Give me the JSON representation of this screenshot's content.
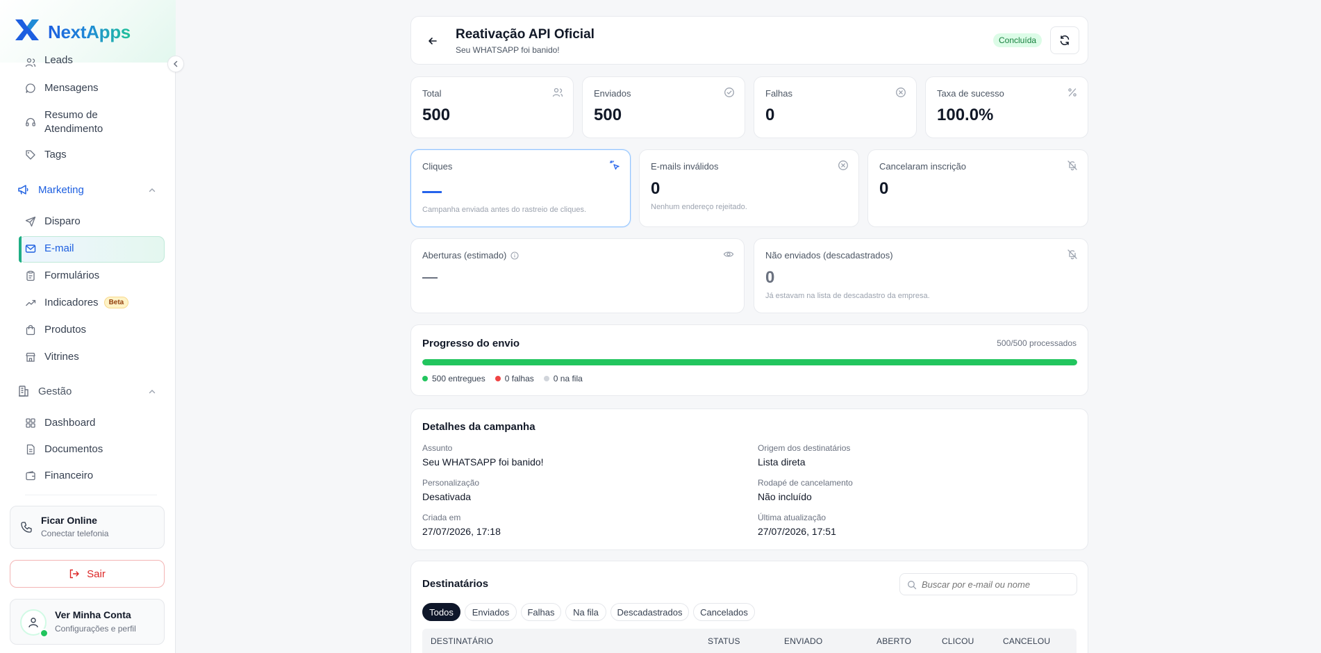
{
  "brand": {
    "name": "NextApps",
    "colors": {
      "primary": "#1d5fe0",
      "accent": "#21c29a"
    }
  },
  "sidebar": {
    "items_top": [
      {
        "label": "Leads",
        "icon": "users-icon"
      },
      {
        "label": "Mensagens",
        "icon": "message-icon"
      },
      {
        "label": "Resumo de Atendimento",
        "icon": "headset-icon"
      },
      {
        "label": "Tags",
        "icon": "tag-icon"
      }
    ],
    "marketing": {
      "label": "Marketing",
      "items": [
        {
          "label": "Disparo",
          "icon": "send-icon"
        },
        {
          "label": "E-mail",
          "icon": "mail-icon",
          "active": true
        },
        {
          "label": "Formulários",
          "icon": "clipboard-icon"
        },
        {
          "label": "Indicadores",
          "icon": "trend-icon",
          "badge": "Beta"
        },
        {
          "label": "Produtos",
          "icon": "bag-icon"
        },
        {
          "label": "Vitrines",
          "icon": "store-icon"
        }
      ]
    },
    "gestao": {
      "label": "Gestão",
      "items": [
        {
          "label": "Dashboard",
          "icon": "grid-icon"
        },
        {
          "label": "Documentos",
          "icon": "document-icon"
        },
        {
          "label": "Financeiro",
          "icon": "wallet-icon"
        }
      ]
    },
    "online": {
      "title": "Ficar Online",
      "subtitle": "Conectar telefonia"
    },
    "logout": "Sair",
    "account": {
      "title": "Ver Minha Conta",
      "subtitle": "Configurações e perfil"
    }
  },
  "header": {
    "title": "Reativação API Oficial",
    "subtitle": "Seu WHATSAPP foi banido!",
    "status": "Concluída"
  },
  "stats": {
    "total": {
      "label": "Total",
      "value": "500"
    },
    "sent": {
      "label": "Enviados",
      "value": "500"
    },
    "failed": {
      "label": "Falhas",
      "value": "0"
    },
    "success": {
      "label": "Taxa de sucesso",
      "value": "100.0%"
    }
  },
  "metrics": {
    "clicks": {
      "label": "Cliques",
      "note": "Campanha enviada antes do rastreio de cliques."
    },
    "invalid": {
      "label": "E-mails inválidos",
      "value": "0",
      "note": "Nenhum endereço rejeitado."
    },
    "unsubscribed": {
      "label": "Cancelaram inscrição",
      "value": "0"
    },
    "opens": {
      "label": "Aberturas (estimado)"
    },
    "not_sent": {
      "label": "Não enviados (descadastrados)",
      "value": "0",
      "note": "Já estavam na lista de descadastro da empresa."
    }
  },
  "progress": {
    "title": "Progresso do envio",
    "processed": "500/500 processados",
    "fraction": 1.0,
    "legend": {
      "delivered": "500 entregues",
      "failed": "0 falhas",
      "queued": "0 na fila"
    }
  },
  "details": {
    "title": "Detalhes da campanha",
    "subject_label": "Assunto",
    "subject": "Seu WHATSAPP foi banido!",
    "origin_label": "Origem dos destinatários",
    "origin": "Lista direta",
    "personalization_label": "Personalização",
    "personalization": "Desativada",
    "footer_label": "Rodapé de cancelamento",
    "footer": "Não incluído",
    "created_label": "Criada em",
    "created": "27/07/2026, 17:18",
    "updated_label": "Última atualização",
    "updated": "27/07/2026, 17:51"
  },
  "recipients": {
    "title": "Destinatários",
    "search_placeholder": "Buscar por e-mail ou nome",
    "filters": [
      "Todos",
      "Enviados",
      "Falhas",
      "Na fila",
      "Descadastrados",
      "Cancelados"
    ],
    "columns": [
      "DESTINATÁRIO",
      "STATUS",
      "ENVIADO",
      "ABERTO",
      "CLICOU",
      "CANCELOU"
    ]
  }
}
